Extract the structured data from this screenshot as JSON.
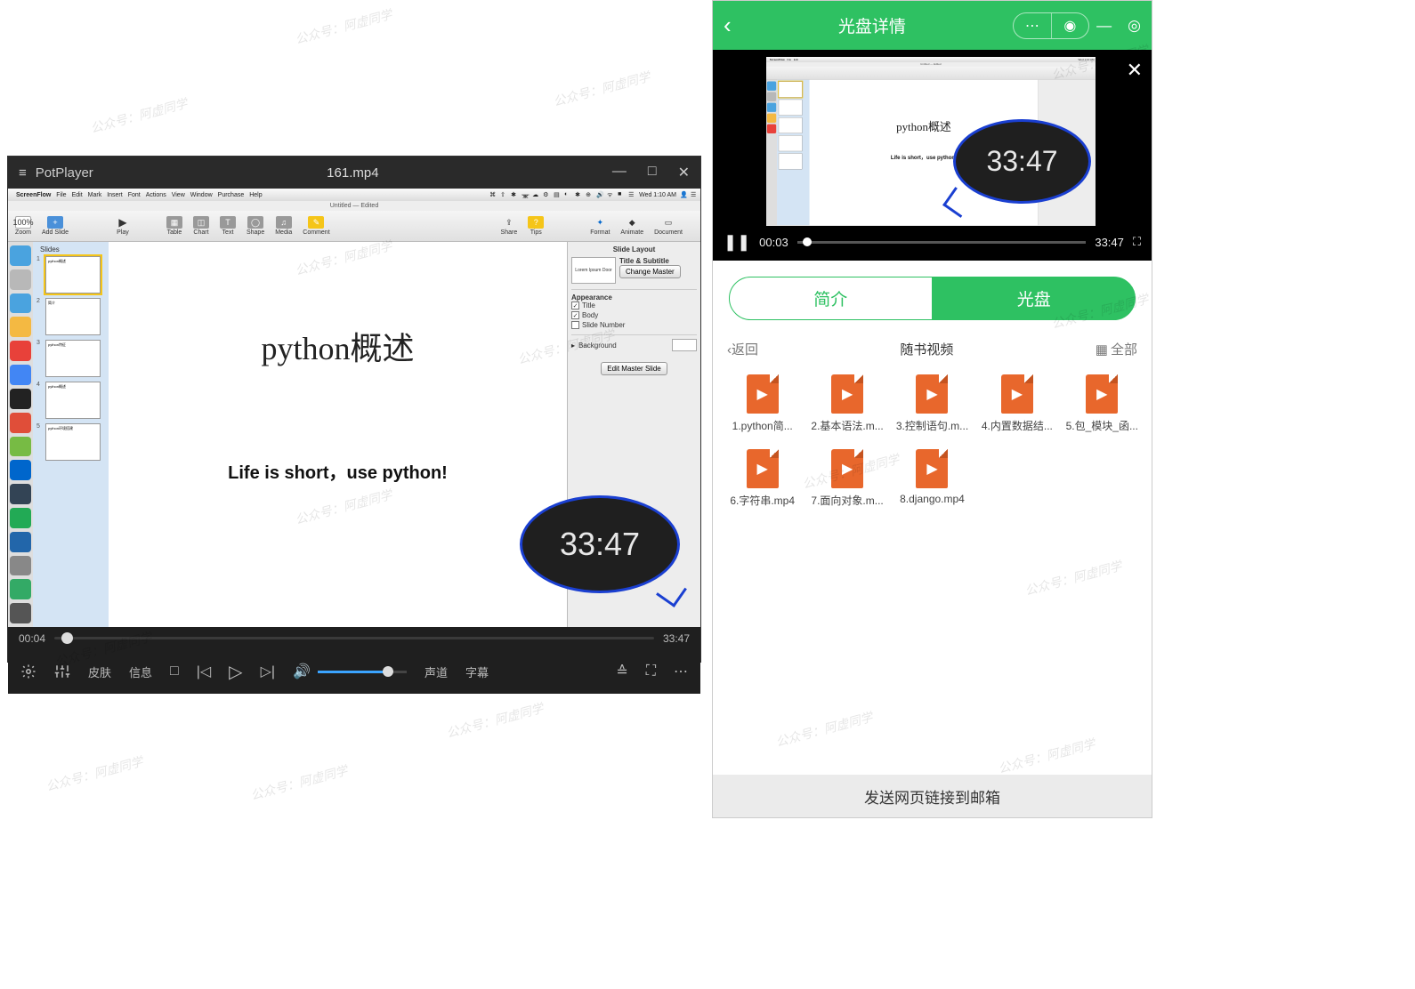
{
  "potplayer": {
    "app_name": "PotPlayer",
    "filename": "161.mp4",
    "current_time": "00:04",
    "total_time": "33:47",
    "controls": {
      "skin": "皮肤",
      "info": "信息",
      "audio": "声道",
      "subtitle": "字幕"
    }
  },
  "mac": {
    "app": "ScreenFlow",
    "menus": [
      "File",
      "Edit",
      "Mark",
      "Insert",
      "Font",
      "Actions",
      "View",
      "Window",
      "Purchase",
      "Help"
    ],
    "clock": "Wed 1:10 AM",
    "doc_title": "Untitled — Edited",
    "toolbar": {
      "zoom": "Zoom",
      "zoom_val": "100%",
      "add_slide": "Add Slide",
      "play": "Play",
      "table": "Table",
      "chart": "Chart",
      "text": "Text",
      "shape": "Shape",
      "media": "Media",
      "comment": "Comment",
      "share": "Share",
      "tips": "Tips",
      "format": "Format",
      "animate": "Animate",
      "document": "Document"
    },
    "slides_header": "Slides",
    "slides": [
      {
        "n": "1",
        "t": "python概述"
      },
      {
        "n": "2",
        "t": "简介"
      },
      {
        "n": "3",
        "t": "python特征"
      },
      {
        "n": "4",
        "t": "python概述"
      },
      {
        "n": "5",
        "t": "python环境搭建"
      }
    ],
    "canvas": {
      "heading": "python概述",
      "sub": "Life is short，use python!"
    },
    "inspector": {
      "slide_layout": "Slide Layout",
      "thumb_text": "Lorem Ipsum Door",
      "title_subtitle": "Title & Subtitle",
      "change_master": "Change Master",
      "appearance": "Appearance",
      "cb_title": "Title",
      "cb_body": "Body",
      "cb_num": "Slide Number",
      "background": "Background",
      "edit_master": "Edit Master Slide"
    }
  },
  "bubble_time": "33:47",
  "wechat": {
    "title": "光盘详情",
    "video": {
      "current": "00:03",
      "total": "33:47"
    },
    "tabs": {
      "intro": "简介",
      "disc": "光盘"
    },
    "nav": {
      "back": "返回",
      "title": "随书视频",
      "all": "全部"
    },
    "files": [
      "1.python简...",
      "2.基本语法.m...",
      "3.控制语句.m...",
      "4.内置数据结...",
      "5.包_模块_函...",
      "6.字符串.mp4",
      "7.面向对象.m...",
      "8.django.mp4"
    ],
    "footer": "发送网页链接到邮箱"
  },
  "watermark": "公众号：阿虚同学"
}
